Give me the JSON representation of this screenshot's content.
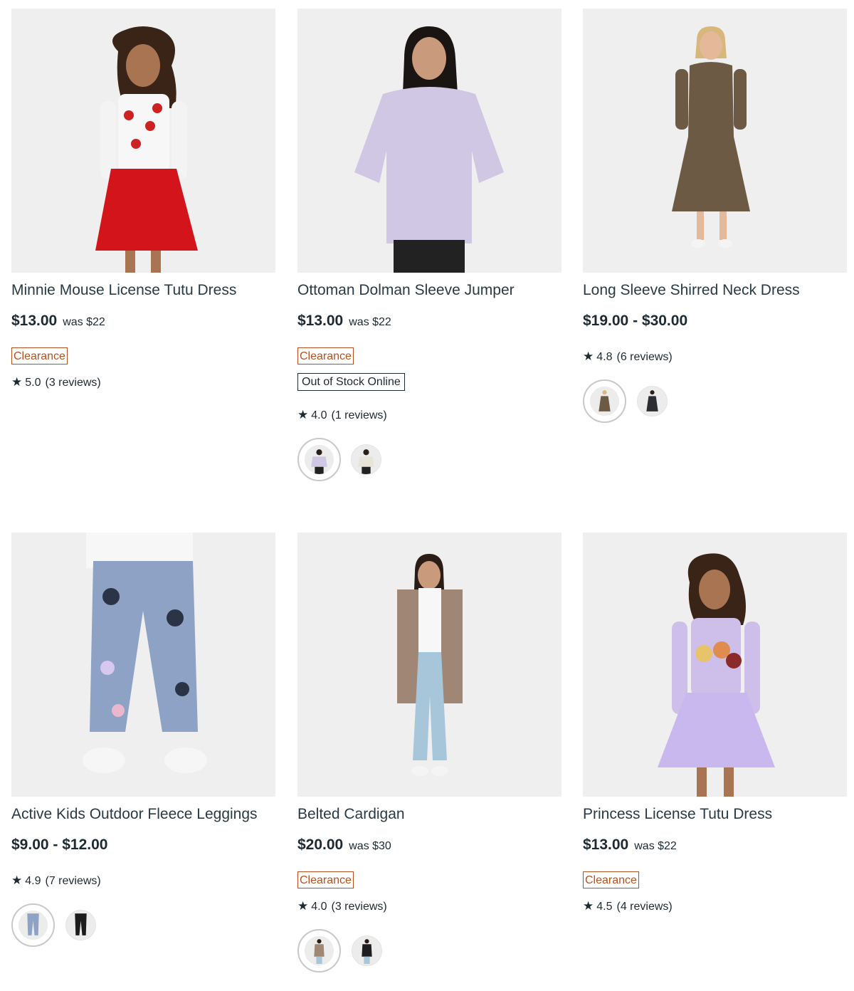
{
  "products": [
    {
      "title": "Minnie Mouse License Tutu Dress",
      "price": "$13.00",
      "was": "was $22",
      "clearance": "Clearance",
      "rating": "5.0",
      "reviews": "(3 reviews)"
    },
    {
      "title": "Ottoman Dolman Sleeve Jumper",
      "price": "$13.00",
      "was": "was $22",
      "clearance": "Clearance",
      "stock": "Out of Stock Online",
      "rating": "4.0",
      "reviews": "(1 reviews)"
    },
    {
      "title": "Long Sleeve Shirred Neck Dress",
      "price": "$19.00 - $30.00",
      "rating": "4.8",
      "reviews": "(6 reviews)"
    },
    {
      "title": "Active Kids Outdoor Fleece Leggings",
      "price": "$9.00 - $12.00",
      "rating": "4.9",
      "reviews": "(7 reviews)"
    },
    {
      "title": "Belted Cardigan",
      "price": "$20.00",
      "was": "was $30",
      "clearance": "Clearance",
      "rating": "4.0",
      "reviews": "(3 reviews)"
    },
    {
      "title": "Princess License Tutu Dress",
      "price": "$13.00",
      "was": "was $22",
      "clearance": "Clearance",
      "rating": "4.5",
      "reviews": "(4 reviews)"
    }
  ],
  "colors": {
    "accent_clearance": "#b4511f",
    "text": "#1e2a32",
    "image_bg": "#efefef"
  },
  "icons": {
    "rating": "star-icon"
  }
}
